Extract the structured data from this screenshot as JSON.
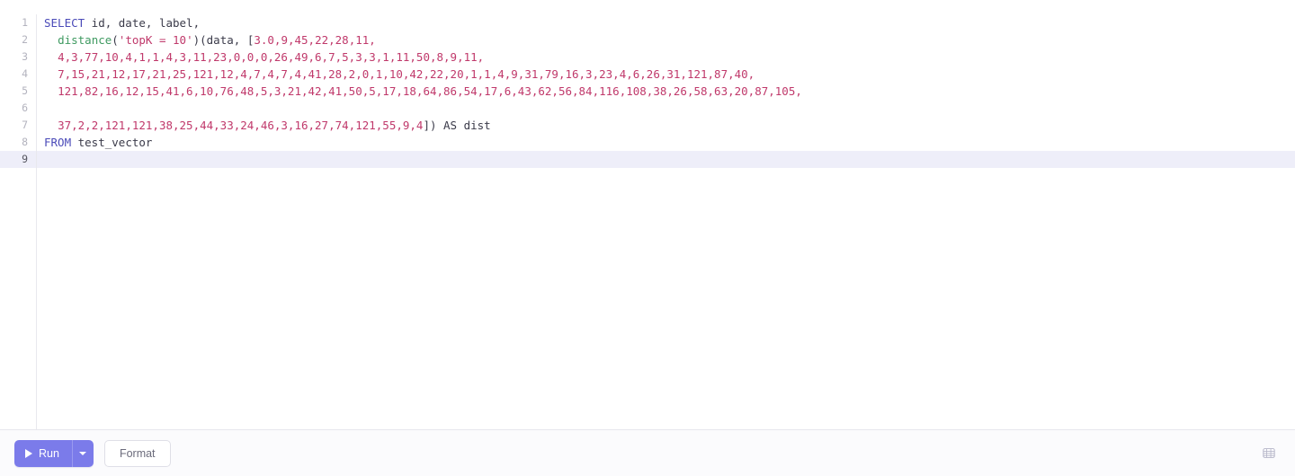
{
  "app": {
    "name": "sql-query-editor",
    "accent_color": "#7b7bea",
    "active_line_bg": "#eeeef9",
    "toolbar_bg": "#fbfbfd"
  },
  "editor": {
    "language": "sql",
    "active_line": 9,
    "cursor_line": 9,
    "lines": [
      {
        "number": "1",
        "tokens": [
          {
            "text": "SELECT",
            "type": "kw"
          },
          {
            "text": " id, date, label,",
            "type": "plain"
          }
        ]
      },
      {
        "number": "2",
        "tokens": [
          {
            "text": "  ",
            "type": "plain"
          },
          {
            "text": "distance",
            "type": "fn"
          },
          {
            "text": "(",
            "type": "punc"
          },
          {
            "text": "'topK = 10'",
            "type": "str"
          },
          {
            "text": ")(data, [",
            "type": "punc"
          },
          {
            "text": "3.0,9,45,22,28,11,",
            "type": "num"
          }
        ]
      },
      {
        "number": "3",
        "tokens": [
          {
            "text": "  ",
            "type": "plain"
          },
          {
            "text": "4,3,77,10,4,1,1,4,3,11,23,0,0,0,26,49,6,7,5,3,3,1,11,50,8,9,11,",
            "type": "num"
          }
        ]
      },
      {
        "number": "4",
        "tokens": [
          {
            "text": "  ",
            "type": "plain"
          },
          {
            "text": "7,15,21,12,17,21,25,121,12,4,7,4,7,4,41,28,2,0,1,10,42,22,20,1,1,4,9,31,79,16,3,23,4,6,26,31,121,87,40,",
            "type": "num"
          }
        ]
      },
      {
        "number": "5",
        "tokens": [
          {
            "text": "  ",
            "type": "plain"
          },
          {
            "text": "121,82,16,12,15,41,6,10,76,48,5,3,21,42,41,50,5,17,18,64,86,54,17,6,43,62,56,84,116,108,38,26,58,63,20,87,105,",
            "type": "num"
          }
        ]
      },
      {
        "number": "6",
        "tokens": []
      },
      {
        "number": "7",
        "tokens": [
          {
            "text": "  ",
            "type": "plain"
          },
          {
            "text": "37,2,2,121,121,38,25,44,33,24,46,3,16,27,74,121,55,9,4",
            "type": "num"
          },
          {
            "text": "]) AS dist",
            "type": "plain"
          }
        ]
      },
      {
        "number": "8",
        "tokens": [
          {
            "text": "FROM",
            "type": "kw"
          },
          {
            "text": " test_vector",
            "type": "plain"
          }
        ]
      },
      {
        "number": "9",
        "tokens": []
      }
    ]
  },
  "toolbar": {
    "run_label": "Run",
    "run_icon": "play-icon",
    "run_dropdown_icon": "chevron-down-icon",
    "format_label": "Format",
    "shortcuts_icon": "keyboard-icon"
  }
}
